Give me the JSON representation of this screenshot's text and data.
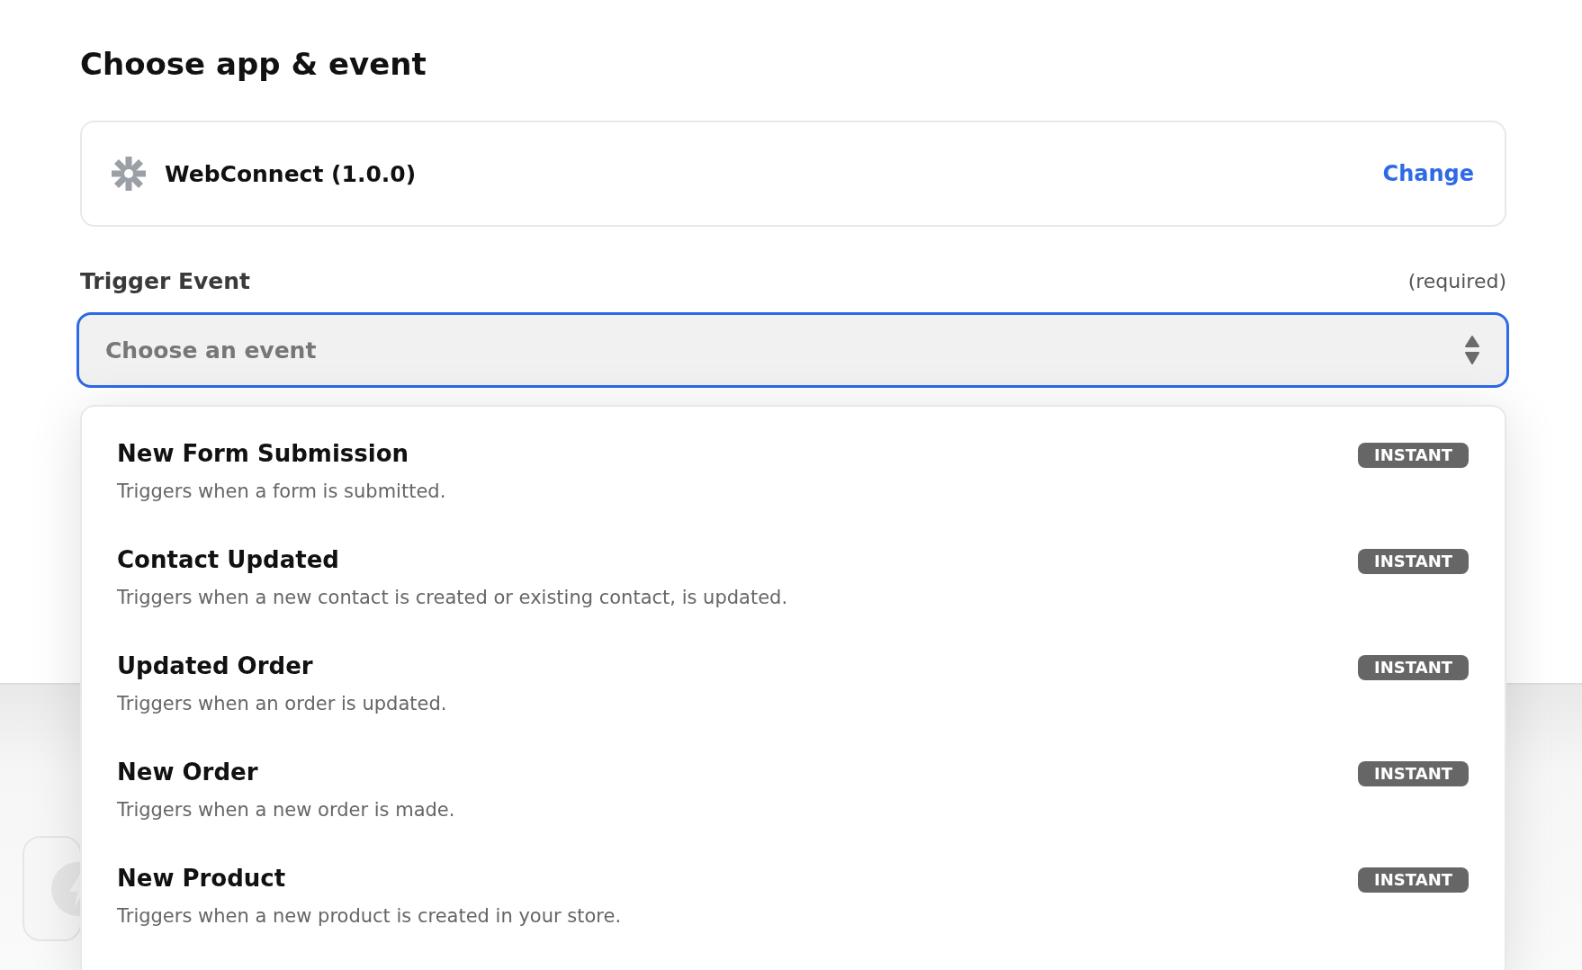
{
  "heading": "Choose app & event",
  "app": {
    "name": "WebConnect (1.0.0)",
    "action": "Change"
  },
  "trigger": {
    "label": "Trigger Event",
    "note": "(required)",
    "placeholder": "Choose an event"
  },
  "events": [
    {
      "title": "New Form Submission",
      "description": "Triggers when a form is submitted.",
      "badge": "INSTANT"
    },
    {
      "title": "Contact Updated",
      "description": "Triggers when a new contact is created or existing contact, is updated.",
      "badge": "INSTANT"
    },
    {
      "title": "Updated Order",
      "description": "Triggers when an order is updated.",
      "badge": "INSTANT"
    },
    {
      "title": "New Order",
      "description": "Triggers when a new order is made.",
      "badge": "INSTANT"
    },
    {
      "title": "New Product",
      "description": "Triggers when a new product is created in your store.",
      "badge": "INSTANT"
    }
  ]
}
